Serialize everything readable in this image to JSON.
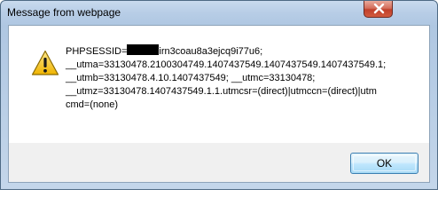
{
  "window": {
    "title": "Message from webpage"
  },
  "dialog": {
    "icon": "warning-icon",
    "message_lines": [
      {
        "before": "PHPSESSID=",
        "redacted": true,
        "after": "irn3coau8a3ejcq9i77u6;"
      },
      {
        "text": "__utma=33130478.2100304749.1407437549.1407437549.1407437549.1;"
      },
      {
        "text": "__utmb=33130478.4.10.1407437549; __utmc=33130478;"
      },
      {
        "text": "__utmz=33130478.1407437549.1.1.utmcsr=(direct)|utmccn=(direct)|utm"
      },
      {
        "text": "cmd=(none)"
      }
    ],
    "ok_label": "OK"
  },
  "colors": {
    "close_button": "#c0402b",
    "ok_border": "#3c7fb1",
    "warning_fill": "#f6c228"
  }
}
